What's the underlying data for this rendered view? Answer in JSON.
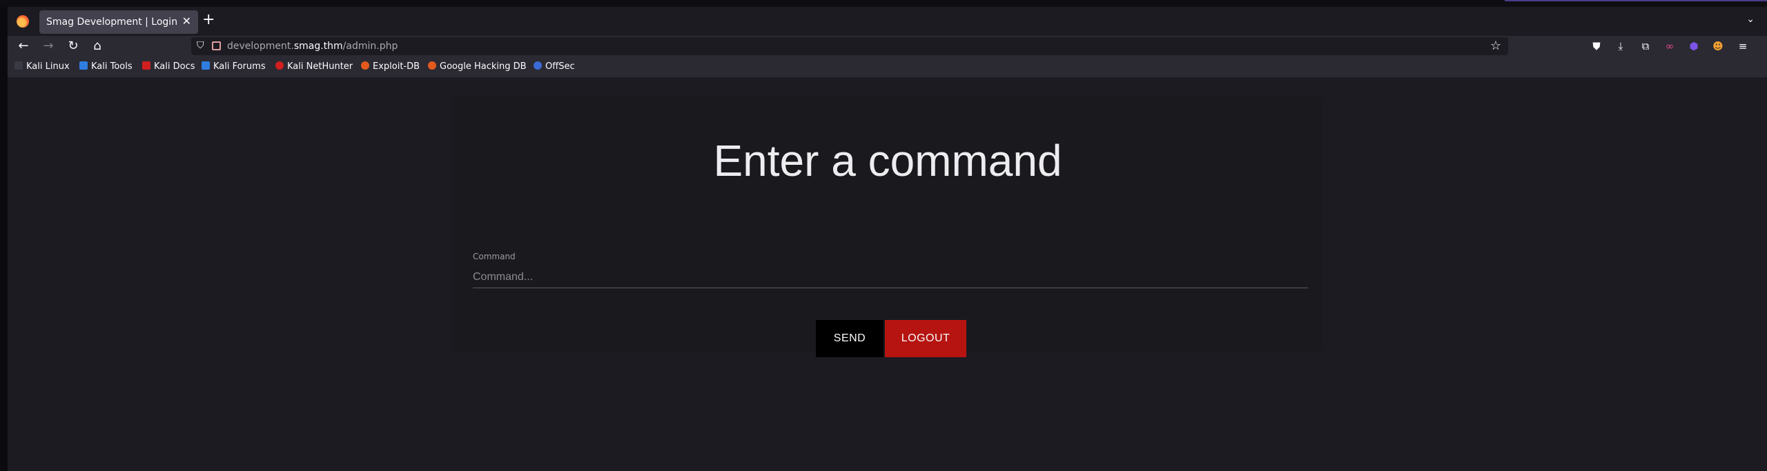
{
  "browser": {
    "tab": {
      "title": "Smag Development | Login",
      "close_glyph": "✕"
    },
    "new_tab_glyph": "+",
    "tablist_glyph": "⌄",
    "url": {
      "prefix": "development.",
      "host": "smag.thm",
      "path": "/admin.php"
    },
    "nav_icons": [
      "back-icon",
      "forward-icon",
      "reload-icon",
      "home-icon"
    ],
    "toolbar_icons": [
      "pocket-icon",
      "download-icon",
      "extensions-icon",
      "mask-icon",
      "extension-purple-icon",
      "profile-icon",
      "menu-icon"
    ]
  },
  "bookmarks": [
    {
      "label": "Kali Linux",
      "color": "#1c1c1c"
    },
    {
      "label": "Kali Tools",
      "color": "#2f7de1"
    },
    {
      "label": "Kali Docs",
      "color": "#d11e1e"
    },
    {
      "label": "Kali Forums",
      "color": "#2f7de1"
    },
    {
      "label": "Kali NetHunter",
      "color": "#d11e1e"
    },
    {
      "label": "Exploit-DB",
      "color": "#e35a1c"
    },
    {
      "label": "Google Hacking DB",
      "color": "#e35a1c"
    },
    {
      "label": "OffSec",
      "color": "#3b6bd6"
    }
  ],
  "page": {
    "heading": "Enter a command",
    "command_label": "Command",
    "command_placeholder": "Command...",
    "send_label": "SEND",
    "logout_label": "LOGOUT"
  },
  "colors": {
    "logout": "#b51410",
    "send": "#000000",
    "card": "#1a1a1e"
  }
}
